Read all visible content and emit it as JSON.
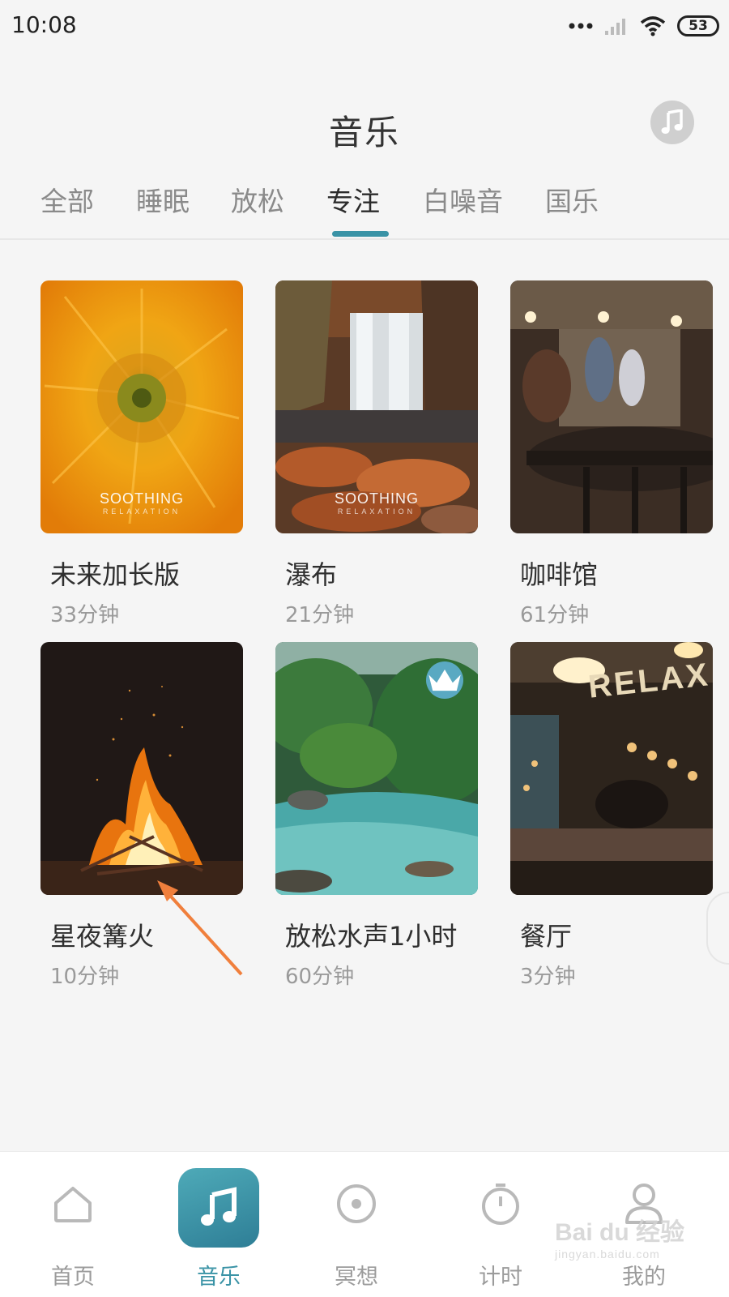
{
  "status_bar": {
    "time": "10:08",
    "battery": "53"
  },
  "header": {
    "title": "音乐"
  },
  "tabs": [
    {
      "label": "全部"
    },
    {
      "label": "睡眠"
    },
    {
      "label": "放松"
    },
    {
      "label": "专注"
    },
    {
      "label": "白噪音"
    },
    {
      "label": "国乐"
    }
  ],
  "active_tab": "专注",
  "cards": [
    {
      "title": "未来加长版",
      "duration": "33分钟",
      "logo": "SOOTHING",
      "logo_sub": "RELAXATION"
    },
    {
      "title": "瀑布",
      "duration": "21分钟",
      "logo": "SOOTHING",
      "logo_sub": "RELAXATION"
    },
    {
      "title": "咖啡馆",
      "duration": "61分钟"
    },
    {
      "title": "星夜篝火",
      "duration": "10分钟"
    },
    {
      "title": "放松水声1小时",
      "duration": "60分钟",
      "premium": true
    },
    {
      "title": "餐厅",
      "duration": "3分钟",
      "sign": "RELAX"
    }
  ],
  "bottom_nav": [
    {
      "label": "首页",
      "icon": "home-icon"
    },
    {
      "label": "音乐",
      "icon": "music-note-icon",
      "active": true
    },
    {
      "label": "冥想",
      "icon": "meditation-icon"
    },
    {
      "label": "计时",
      "icon": "timer-icon"
    },
    {
      "label": "我的",
      "icon": "profile-icon"
    }
  ],
  "watermark": {
    "text": "Bai du 经验",
    "sub": "jingyan.baidu.com"
  },
  "colors": {
    "accent": "#3a93a6",
    "background": "#f5f5f5"
  }
}
